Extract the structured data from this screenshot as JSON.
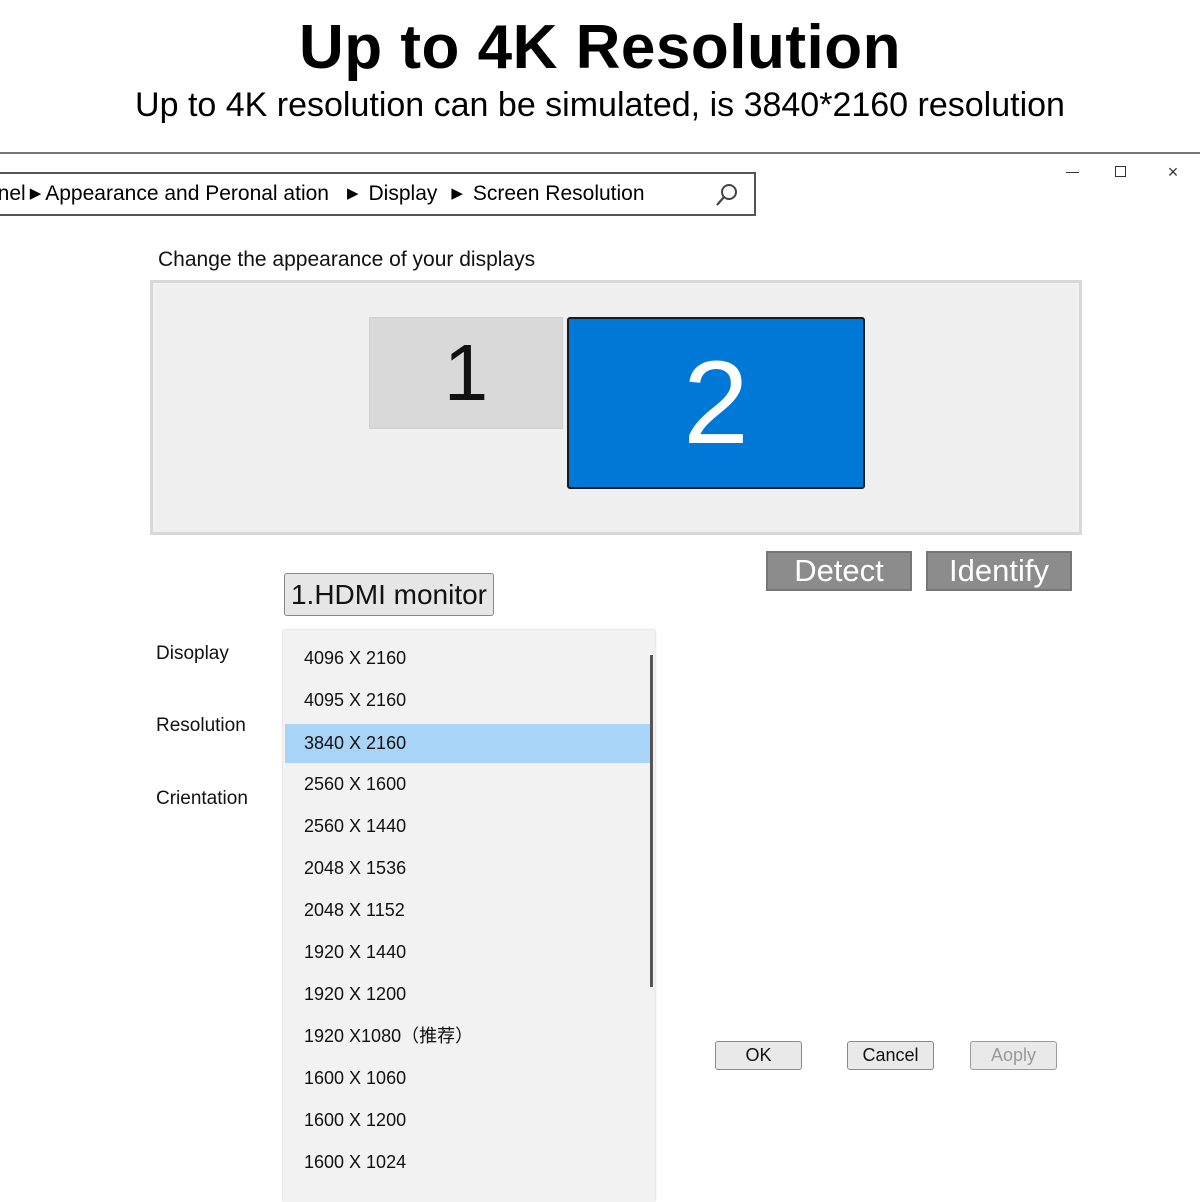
{
  "banner": {
    "headline": "Up to 4K Resolution",
    "subline": "Up to 4K resolution can be simulated, is 3840*2160 resolution"
  },
  "window": {
    "controls": {
      "minimize_icon": "minimize-icon",
      "maximize_icon": "maximize-icon",
      "close_icon": "close-icon",
      "close_glyph": "×"
    }
  },
  "address_bar": {
    "crumbs": [
      "anel",
      "Appearance and Peronal ation",
      "Display",
      "Screen Resolution"
    ],
    "separator": "▶",
    "search_icon": "search-icon"
  },
  "display_settings": {
    "title": "Change the appearance of your displays",
    "monitors": [
      {
        "label": "1",
        "selected": false,
        "color": "#d9d9d9"
      },
      {
        "label": "2",
        "selected": true,
        "color": "#0078d7"
      }
    ],
    "detect_label": "Detect",
    "identify_label": "Identify",
    "monitor_select_value": "1.HDMI monitor",
    "labels": {
      "display": "Disoplay",
      "resolution": "Resolution",
      "orientation": "Crientation"
    }
  },
  "resolution_list": {
    "items": [
      "4096 X 2160",
      "4095 X 2160",
      "3840 X 2160",
      "2560 X 1600",
      "2560 X 1440",
      "2048 X 1536",
      "2048 X 1152",
      "1920 X 1440",
      "1920 X 1200",
      "1920 X1080（推荐）",
      "1600 X 1060",
      "1600 X 1200",
      "1600 X 1024"
    ],
    "selected_index": 2,
    "selected_color": "#a8d4f7"
  },
  "dialog_buttons": {
    "ok": "OK",
    "cancel": "Cancel",
    "apply": "Aoply"
  }
}
